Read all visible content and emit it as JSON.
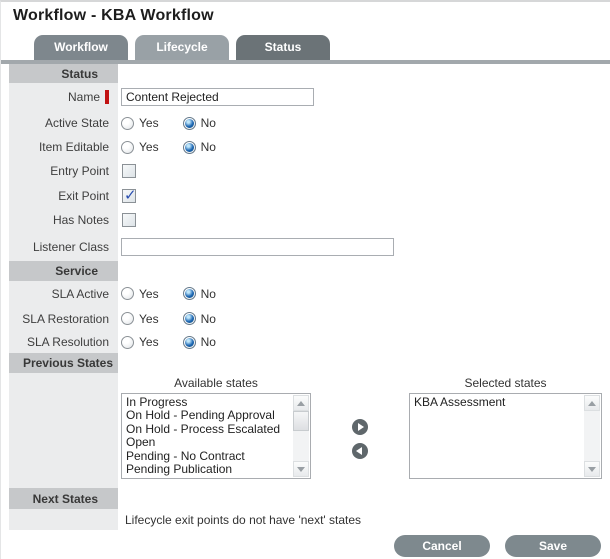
{
  "title": "Workflow - KBA Workflow",
  "tabs": {
    "workflow": "Workflow",
    "lifecycle": "Lifecycle",
    "status": "Status",
    "active_tab": "Status"
  },
  "sections": {
    "status": "Status",
    "service": "Service",
    "previous_states": "Previous States",
    "next_states": "Next States"
  },
  "fields": {
    "name": {
      "label": "Name",
      "required": true,
      "value": "Content Rejected"
    },
    "active_state": {
      "label": "Active State",
      "options": [
        "Yes",
        "No"
      ],
      "value": "No"
    },
    "item_editable": {
      "label": "Item Editable",
      "options": [
        "Yes",
        "No"
      ],
      "value": "No"
    },
    "entry_point": {
      "label": "Entry Point",
      "checked": false
    },
    "exit_point": {
      "label": "Exit Point",
      "checked": true
    },
    "has_notes": {
      "label": "Has Notes",
      "checked": false
    },
    "listener_class": {
      "label": "Listener Class",
      "value": ""
    },
    "sla_active": {
      "label": "SLA Active",
      "options": [
        "Yes",
        "No"
      ],
      "value": "No"
    },
    "sla_restoration": {
      "label": "SLA Restoration",
      "options": [
        "Yes",
        "No"
      ],
      "value": "No"
    },
    "sla_resolution": {
      "label": "SLA Resolution",
      "options": [
        "Yes",
        "No"
      ],
      "value": "No"
    }
  },
  "previous_states": {
    "available": {
      "caption": "Available states",
      "items": [
        "In Progress",
        "On Hold - Pending Approval",
        "On Hold - Process Escalated",
        "Open",
        "Pending - No Contract",
        "Pending Publication"
      ]
    },
    "selected": {
      "caption": "Selected states",
      "items": [
        "KBA Assessment"
      ]
    }
  },
  "next_states_message": "Lifecycle exit points do not have 'next' states",
  "buttons": {
    "cancel": "Cancel",
    "save": "Save"
  },
  "colors": {
    "tab_active": "#6b7377",
    "radio_accent": "#1e68b4",
    "required_marker": "#c11212",
    "button_gray": "#7e898e"
  }
}
